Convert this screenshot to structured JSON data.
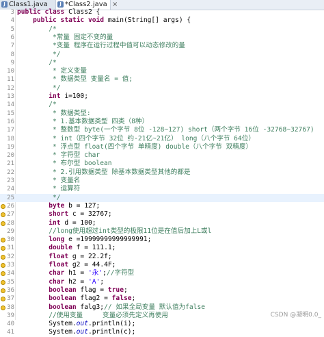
{
  "tabs": [
    {
      "label": "Class1.java",
      "close": "×"
    },
    {
      "label": "*Class2.java",
      "close": "×"
    }
  ],
  "editor": {
    "lines": [
      {
        "n": "3",
        "parts": [
          [
            "kw",
            "public"
          ],
          [
            "",
            "&nbsp;"
          ],
          [
            "kw",
            "class"
          ],
          [
            "",
            "&nbsp;Class2&nbsp;{"
          ]
        ]
      },
      {
        "n": "4",
        "parts": [
          [
            "",
            "&nbsp;&nbsp;&nbsp;&nbsp;"
          ],
          [
            "kw",
            "public"
          ],
          [
            "",
            ""
          ],
          [
            "kw",
            "static"
          ],
          [
            "",
            ""
          ],
          [
            "kw",
            "void"
          ],
          [
            "",
            ""
          ]
        ]
      }
    ],
    "text": [
      "public class Class2 {",
      "    public static void main(String[] args) {",
      "        /*",
      "         *常量 固定不变的量",
      "         *变量 程序在运行过程中值可以动态修改的量",
      "         */",
      "        /*",
      "         * 定义变量",
      "         * 数据类型 变量名 = 值;",
      "         */",
      "        int i=100;",
      "        /*",
      "         * 数据类型:",
      "         * 1.基本数据类型 四类（8种）",
      "         * 整数型 byte(一个字节 8位 -128~127) short（两个字节 16位 -32768~32767)",
      "         * int（四个字节 32位 约-21亿~21亿） long（八个字节 64位）",
      "         * 浮点型 float(四个字节 单精度) double（八个字节 双精度）",
      "         * 字符型 char",
      "         * 布尔型 boolean",
      "         * 2.引用数据类型 除基本数据类型其他的都是",
      "         * 变量名",
      "         * 运算符",
      "         */",
      "        byte b = 127;",
      "        short c = 32767;",
      "        int d = 100;",
      "        //long使用超过int类型的极限11位是在值后加上L或l",
      "        long e =19999999999999991;",
      "        double f = 111.1;",
      "        float g = 22.2f;",
      "        float g2 = 44.4F;",
      "        char h1 = '永';//字符型",
      "        char h2 = 'A';",
      "        boolean flag = true;",
      "        boolean flag2 = false;",
      "        boolean falg3;// 如果全局变量 默认值为false",
      "        //使用变量     变量必须先定义再使用",
      "        System.out.println(i);",
      "        System.out.println(c);"
    ],
    "line_numbers": [
      "3",
      "4",
      "5",
      "6",
      "7",
      "8",
      "9",
      "10",
      "11",
      "12",
      "13",
      "14",
      "15",
      "16",
      "17",
      "18",
      "19",
      "20",
      "21",
      "22",
      "23",
      "24",
      "25",
      "26",
      "27",
      "28",
      "29",
      "30",
      "31",
      "32",
      "33",
      "34",
      "35",
      "36",
      "37",
      "38",
      "39",
      "40",
      "41"
    ]
  },
  "watermark": "CSDN @凝明0.0_"
}
